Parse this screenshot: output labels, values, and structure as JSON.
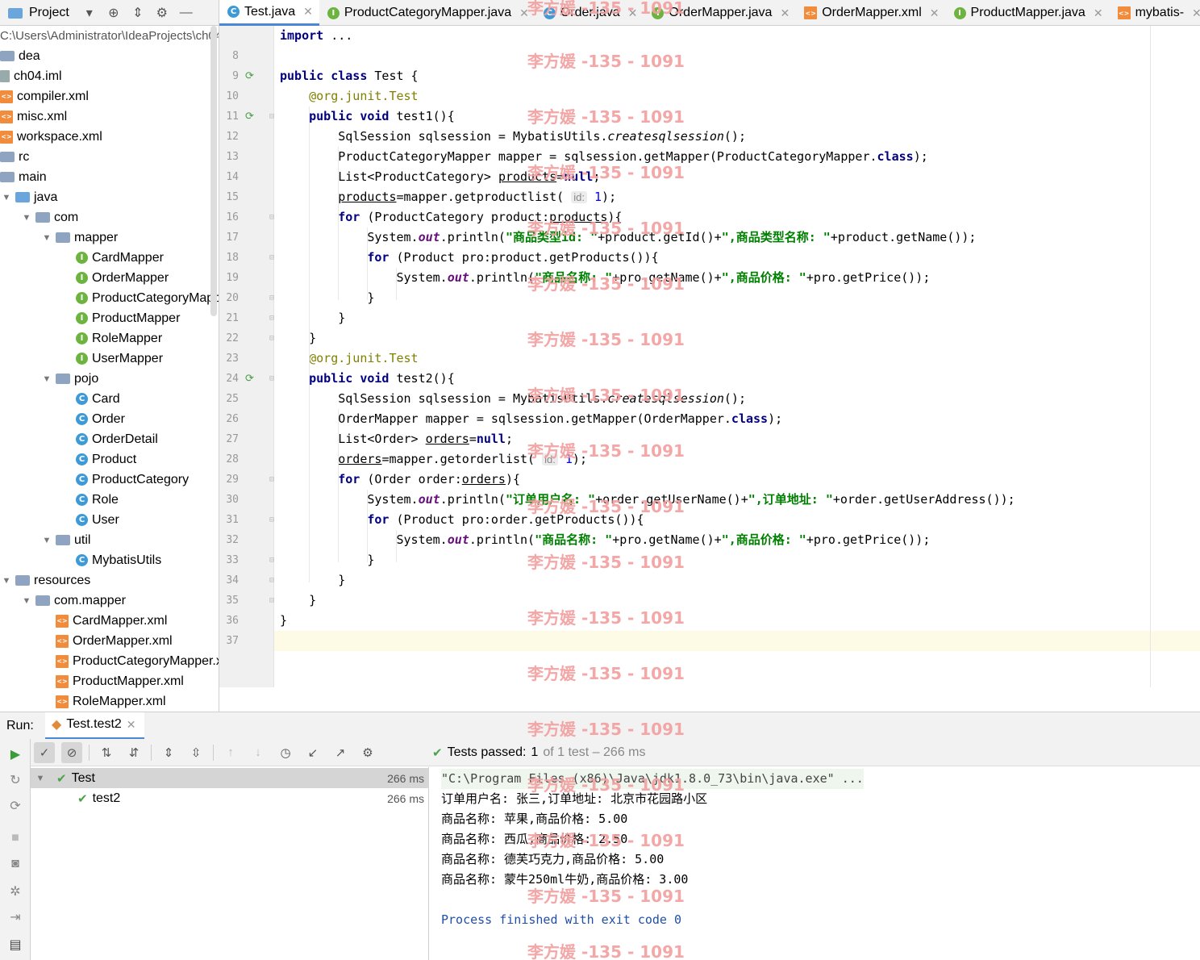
{
  "project_panel": {
    "title": "Project",
    "path": "C:\\Users\\Administrator\\IdeaProjects\\ch04",
    "items": [
      {
        "label": "dea",
        "icon": "folder-icon",
        "depth": 0
      },
      {
        "label": "ch04.iml",
        "icon": "file-icon",
        "depth": 0
      },
      {
        "label": "compiler.xml",
        "icon": "xml-file-icon",
        "depth": 0
      },
      {
        "label": "misc.xml",
        "icon": "xml-file-icon",
        "depth": 0
      },
      {
        "label": "workspace.xml",
        "icon": "xml-file-icon",
        "depth": 0
      },
      {
        "label": "rc",
        "icon": "folder-icon",
        "depth": 0
      },
      {
        "label": "main",
        "icon": "folder-icon",
        "depth": 0
      },
      {
        "label": "java",
        "icon": "source-folder-icon",
        "depth": 1
      },
      {
        "label": "com",
        "icon": "package-icon",
        "depth": 2
      },
      {
        "label": "mapper",
        "icon": "package-icon",
        "depth": 3
      },
      {
        "label": "CardMapper",
        "icon": "interface-icon",
        "depth": 4
      },
      {
        "label": "OrderMapper",
        "icon": "interface-icon",
        "depth": 4
      },
      {
        "label": "ProductCategoryMapper",
        "icon": "interface-icon",
        "depth": 4
      },
      {
        "label": "ProductMapper",
        "icon": "interface-icon",
        "depth": 4
      },
      {
        "label": "RoleMapper",
        "icon": "interface-icon",
        "depth": 4
      },
      {
        "label": "UserMapper",
        "icon": "interface-icon",
        "depth": 4
      },
      {
        "label": "pojo",
        "icon": "package-icon",
        "depth": 3
      },
      {
        "label": "Card",
        "icon": "class-icon",
        "depth": 4
      },
      {
        "label": "Order",
        "icon": "class-icon",
        "depth": 4
      },
      {
        "label": "OrderDetail",
        "icon": "class-icon",
        "depth": 4
      },
      {
        "label": "Product",
        "icon": "class-icon",
        "depth": 4
      },
      {
        "label": "ProductCategory",
        "icon": "class-icon",
        "depth": 4
      },
      {
        "label": "Role",
        "icon": "class-icon",
        "depth": 4
      },
      {
        "label": "User",
        "icon": "class-icon",
        "depth": 4
      },
      {
        "label": "util",
        "icon": "package-icon",
        "depth": 3
      },
      {
        "label": "MybatisUtils",
        "icon": "class-icon",
        "depth": 4
      },
      {
        "label": "resources",
        "icon": "resources-folder-icon",
        "depth": 1
      },
      {
        "label": "com.mapper",
        "icon": "package-icon",
        "depth": 2
      },
      {
        "label": "CardMapper.xml",
        "icon": "xml-file-icon",
        "depth": 3
      },
      {
        "label": "OrderMapper.xml",
        "icon": "xml-file-icon",
        "depth": 3
      },
      {
        "label": "ProductCategoryMapper.xml",
        "icon": "xml-file-icon",
        "depth": 3
      },
      {
        "label": "ProductMapper.xml",
        "icon": "xml-file-icon",
        "depth": 3
      },
      {
        "label": "RoleMapper.xml",
        "icon": "xml-file-icon",
        "depth": 3
      }
    ]
  },
  "tabs": [
    {
      "label": "Test.java",
      "icon": "class-icon",
      "active": true
    },
    {
      "label": "ProductCategoryMapper.java",
      "icon": "interface-icon",
      "active": false
    },
    {
      "label": "Order.java",
      "icon": "class-icon",
      "active": false
    },
    {
      "label": "OrderMapper.java",
      "icon": "interface-icon",
      "active": false
    },
    {
      "label": "OrderMapper.xml",
      "icon": "xml-file-icon",
      "active": false
    },
    {
      "label": "ProductMapper.java",
      "icon": "interface-icon",
      "active": false
    },
    {
      "label": "mybatis-",
      "icon": "xml-file-icon",
      "active": false
    }
  ],
  "editor": {
    "first_line": 7,
    "current_line": 37,
    "lines": [
      "import ...",
      "",
      "public class Test {",
      "    @org.junit.Test",
      "    public void test1(){",
      "        SqlSession sqlsession = MybatisUtils.createsqlsession();",
      "        ProductCategoryMapper mapper = sqlsession.getMapper(ProductCategoryMapper.class);",
      "        List<ProductCategory> products=null;",
      "        products=mapper.getproductlist( id: 1);",
      "        for (ProductCategory product:products){",
      "            System.out.println(\"商品类型id: \"+product.getId()+\",商品类型名称: \"+product.getName());",
      "            for (Product pro:product.getProducts()){",
      "                System.out.println(\"商品名称: \"+pro.getName()+\",商品价格: \"+pro.getPrice());",
      "            }",
      "        }",
      "    }",
      "    @org.junit.Test",
      "    public void test2(){",
      "        SqlSession sqlsession = MybatisUtils.createsqlsession();",
      "        OrderMapper mapper = sqlsession.getMapper(OrderMapper.class);",
      "        List<Order> orders=null;",
      "        orders=mapper.getorderlist( id: 1);",
      "        for (Order order:orders){",
      "            System.out.println(\"订单用户名: \"+order.getUserName()+\",订单地址: \"+order.getUserAddress());",
      "            for (Product pro:order.getProducts()){",
      "                System.out.println(\"商品名称: \"+pro.getName()+\",商品价格: \"+pro.getPrice());",
      "            }",
      "        }",
      "    }",
      "}",
      ""
    ],
    "run_marker_lines": [
      9,
      11,
      24
    ]
  },
  "run_panel": {
    "label": "Run:",
    "tab": "Test.test2",
    "status": {
      "prefix": "Tests passed:",
      "passed": "1",
      "rest": "of 1 test – 266 ms"
    },
    "tests": [
      {
        "name": "Test",
        "duration": "266 ms",
        "selected": true
      },
      {
        "name": "test2",
        "duration": "266 ms",
        "selected": false
      }
    ],
    "console": [
      "\"C:\\Program Files (x86)\\Java\\jdk1.8.0_73\\bin\\java.exe\" ...",
      "订单用户名: 张三,订单地址: 北京市花园路小区",
      "商品名称: 苹果,商品价格: 5.00",
      "商品名称: 西瓜,商品价格: 2.50",
      "商品名称: 德芙巧克力,商品价格: 5.00",
      "商品名称: 蒙牛250ml牛奶,商品价格: 3.00",
      "",
      "Process finished with exit code 0"
    ]
  },
  "watermark": "李方媛 -135 - 1091",
  "colors": {
    "accent": "#4a87d6",
    "keyword": "#000080",
    "string": "#008000",
    "watermark": "#f3a0a0",
    "pass": "#4aa34a"
  }
}
